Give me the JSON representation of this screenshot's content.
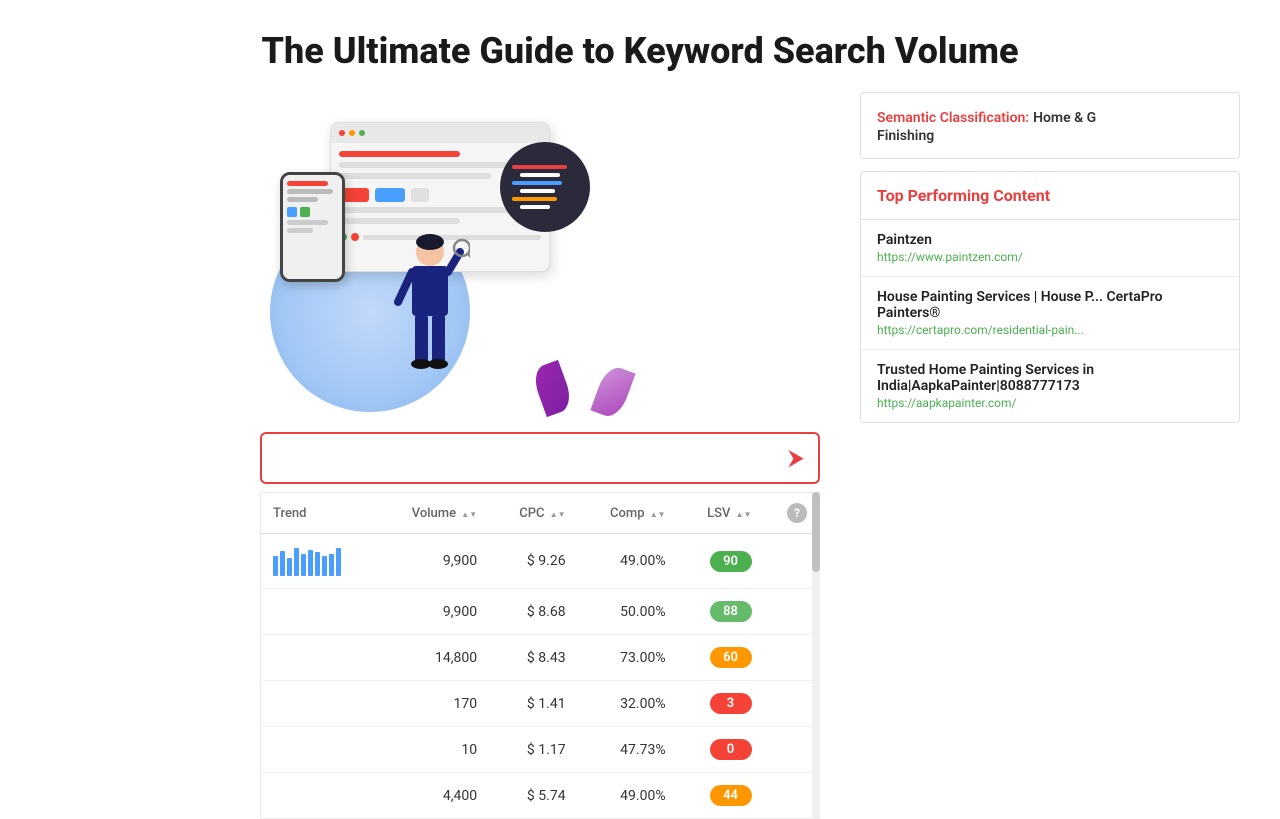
{
  "page": {
    "title": "The Ultimate Guide to Keyword Search Volume"
  },
  "search_bar": {
    "placeholder": ""
  },
  "table": {
    "columns": [
      {
        "label": "Trend",
        "sortable": false
      },
      {
        "label": "Volume",
        "sortable": true
      },
      {
        "label": "CPC",
        "sortable": true
      },
      {
        "label": "Comp",
        "sortable": true
      },
      {
        "label": "LSV",
        "sortable": true
      },
      {
        "label": "?",
        "sortable": false
      }
    ],
    "rows": [
      {
        "trend": "bars",
        "volume": "9,900",
        "cpc": "$ 9.26",
        "comp": "49.00%",
        "lsv": "90",
        "lsv_color": "green"
      },
      {
        "trend": "",
        "volume": "9,900",
        "cpc": "$ 8.68",
        "comp": "50.00%",
        "lsv": "88",
        "lsv_color": "green2"
      },
      {
        "trend": "",
        "volume": "14,800",
        "cpc": "$ 8.43",
        "comp": "73.00%",
        "lsv": "60",
        "lsv_color": "orange"
      },
      {
        "trend": "",
        "volume": "170",
        "cpc": "$ 1.41",
        "comp": "32.00%",
        "lsv": "3",
        "lsv_color": "red"
      },
      {
        "trend": "",
        "volume": "10",
        "cpc": "$ 1.17",
        "comp": "47.73%",
        "lsv": "0",
        "lsv_color": "red"
      },
      {
        "trend": "",
        "volume": "4,400",
        "cpc": "$ 5.74",
        "comp": "49.00%",
        "lsv": "44",
        "lsv_color": "orange2"
      }
    ]
  },
  "right_panel": {
    "semantic": {
      "label": "Semantic Classification:",
      "value": "Home & G",
      "sub": "Finishing"
    },
    "top_content": {
      "title": "Top Performing Content",
      "items": [
        {
          "title": "Paintzen",
          "url": "https://www.paintzen.com/"
        },
        {
          "title": "House Painting Services | House P... CertaPro Painters®",
          "url": "https://certapro.com/residential-pain..."
        },
        {
          "title": "Trusted Home Painting Services in India|AapkaPainter|8088777173",
          "url": "https://aapkapainter.com/"
        }
      ]
    }
  },
  "trend_bars": {
    "heights": [
      20,
      25,
      18,
      28,
      22,
      26,
      24,
      20,
      22,
      28
    ]
  }
}
